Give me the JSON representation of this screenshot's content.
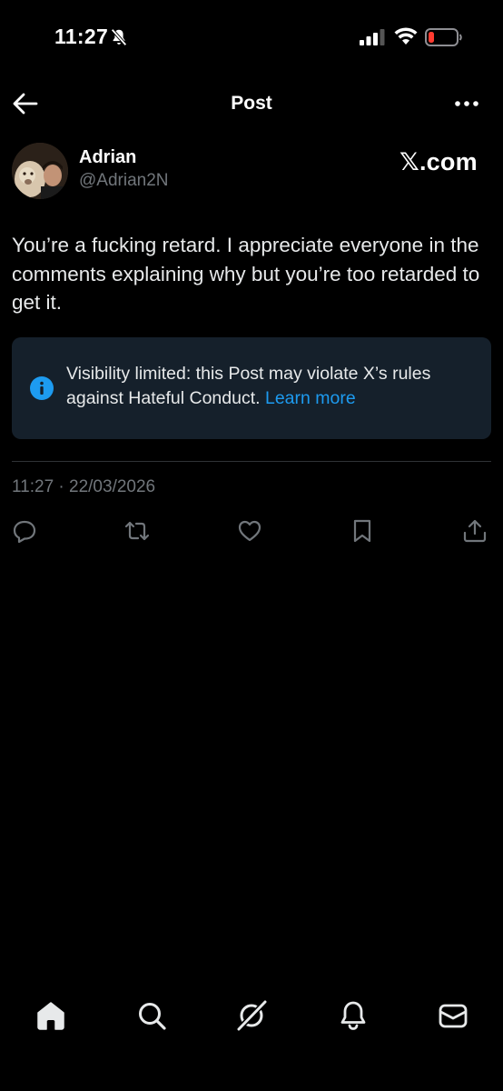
{
  "status_bar": {
    "time": "11:27",
    "icons": [
      "bell-slash-icon",
      "signal-icon",
      "wifi-icon",
      "battery-low-icon"
    ],
    "battery_color": "#ff3b30"
  },
  "header": {
    "title": "Post",
    "back_icon": "arrow-left-icon",
    "more_icon": "more-horizontal-icon"
  },
  "author": {
    "name": "Adrian",
    "handle": "@Adrian2N",
    "badge": "𝕏.com"
  },
  "post": {
    "text": "You’re a fucking retard. I appreciate everyone in the comments explaining why but you’re too retarded to get it.",
    "timestamp": "11:27 · 22/03/2026"
  },
  "notice": {
    "icon": "info-icon",
    "text": "Visibility limited: this Post may violate X’s rules against Hateful Conduct. ",
    "link": "Learn more"
  },
  "actions": [
    "reply-icon",
    "repost-icon",
    "like-icon",
    "bookmark-icon",
    "share-icon"
  ],
  "bottom_nav": [
    "home-icon",
    "search-icon",
    "grok-icon",
    "notifications-icon",
    "messages-icon"
  ],
  "colors": {
    "background": "#000000",
    "text": "#e7e9ea",
    "secondary": "#71767b",
    "accent": "#1d9bf0",
    "notice_bg": "#15202b"
  }
}
